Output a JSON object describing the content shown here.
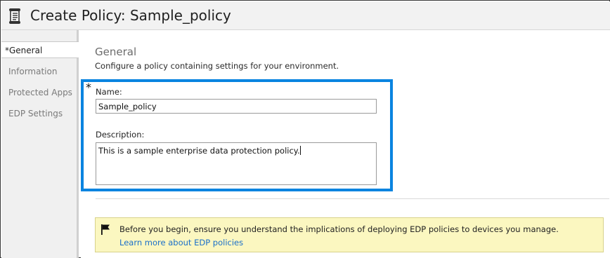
{
  "window": {
    "title": "Create Policy: Sample_policy"
  },
  "sidebar": {
    "items": [
      {
        "label": "*General",
        "selected": true
      },
      {
        "label": "Information"
      },
      {
        "label": "Protected Apps"
      },
      {
        "label": "EDP Settings"
      }
    ]
  },
  "general": {
    "heading": "General",
    "description": "Configure a policy containing settings for your environment.",
    "required_marker": "*",
    "name_label": "Name:",
    "name_value": "Sample_policy",
    "description_label": "Description:",
    "description_value": "This is a sample enterprise data protection policy."
  },
  "notice": {
    "text": "Before you begin, ensure you understand the implications of deploying EDP policies to devices you manage.",
    "link": "Learn more about EDP policies"
  },
  "colors": {
    "highlight": "#0a84e0",
    "notice_bg": "#fbf7c0",
    "link": "#1a6fc9"
  },
  "icons": {
    "title": "policy-scroll-icon",
    "notice": "flag-icon"
  }
}
